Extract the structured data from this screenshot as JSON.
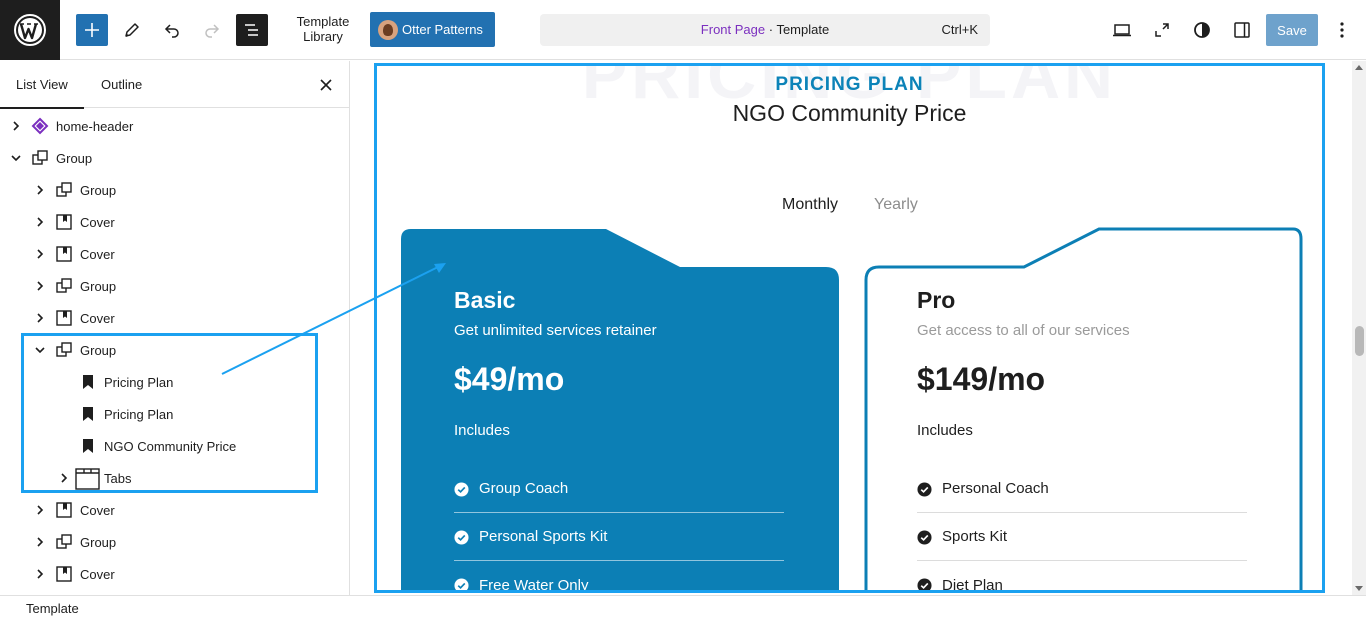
{
  "toolbar": {
    "add_label": "+",
    "template_library": "Template Library",
    "otter_patterns": "Otter Patterns",
    "doc_page": "Front Page",
    "doc_separator": " · ",
    "doc_type": "Template",
    "shortcut": "Ctrl+K",
    "save": "Save",
    "accent": "#2271b1"
  },
  "sidebar": {
    "tabs": [
      "List View",
      "Outline"
    ],
    "close_icon": "close-icon",
    "items": [
      {
        "label": "home-header",
        "icon": "diamond-icon",
        "depth": 0,
        "chevron": "right"
      },
      {
        "label": "Group",
        "icon": "group-icon",
        "depth": 0,
        "chevron": "down"
      },
      {
        "label": "Group",
        "icon": "group-icon",
        "depth": 1,
        "chevron": "right"
      },
      {
        "label": "Cover",
        "icon": "cover-icon",
        "depth": 1,
        "chevron": "right"
      },
      {
        "label": "Cover",
        "icon": "cover-icon",
        "depth": 1,
        "chevron": "right"
      },
      {
        "label": "Group",
        "icon": "group-icon",
        "depth": 1,
        "chevron": "right"
      },
      {
        "label": "Cover",
        "icon": "cover-icon",
        "depth": 1,
        "chevron": "right"
      },
      {
        "label": "Group",
        "icon": "group-icon",
        "depth": 1,
        "chevron": "down"
      },
      {
        "label": "Pricing Plan",
        "icon": "bookmark-icon",
        "depth": 2,
        "chevron": "none"
      },
      {
        "label": "Pricing Plan",
        "icon": "bookmark-icon",
        "depth": 2,
        "chevron": "none"
      },
      {
        "label": "NGO Community Price",
        "icon": "bookmark-icon",
        "depth": 2,
        "chevron": "none"
      },
      {
        "label": "Tabs",
        "icon": "tabs-icon",
        "depth": 2,
        "chevron": "right"
      },
      {
        "label": "Cover",
        "icon": "cover-icon",
        "depth": 1,
        "chevron": "right"
      },
      {
        "label": "Group",
        "icon": "group-icon",
        "depth": 1,
        "chevron": "right"
      },
      {
        "label": "Cover",
        "icon": "cover-icon",
        "depth": 1,
        "chevron": "right"
      }
    ]
  },
  "canvas": {
    "watermark": "PRICING PLAN",
    "eyebrow": "PRICING PLAN",
    "title": "NGO Community Price",
    "toggle": {
      "monthly": "Monthly",
      "yearly": "Yearly"
    },
    "cards": [
      {
        "name": "Basic",
        "description": "Get unlimited services retainer",
        "price": "$49/mo",
        "includes": "Includes",
        "features": [
          "Group Coach",
          "Personal Sports Kit",
          "Free Water Only"
        ],
        "bg": "#0c7fb5"
      },
      {
        "name": "Pro",
        "description": "Get access to all of our services",
        "price": "$149/mo",
        "includes": "Includes",
        "features": [
          "Personal Coach",
          "Sports Kit",
          "Diet Plan"
        ],
        "border": "#0c7fb5"
      }
    ],
    "highlight_color": "#1ba1f0"
  },
  "footer": {
    "breadcrumb": "Template"
  }
}
